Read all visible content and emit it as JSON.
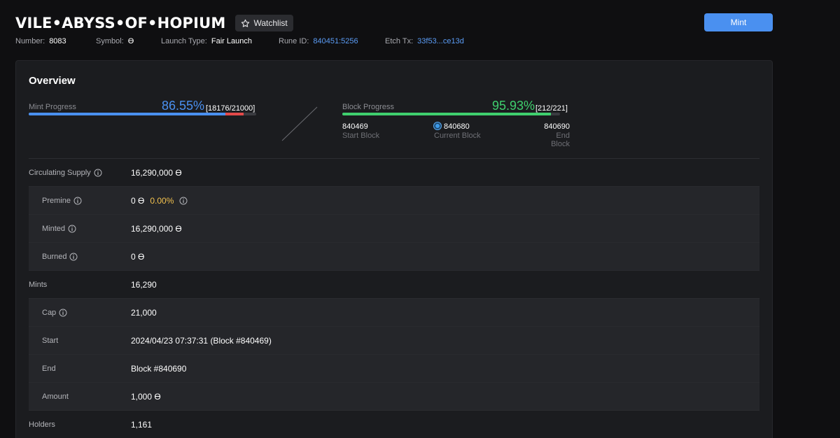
{
  "header": {
    "rune_name": "VILE•ABYSS•OF•HOPIUM",
    "watchlist_label": "Watchlist",
    "mint_label": "Mint"
  },
  "meta": {
    "number_label": "Number:",
    "number_value": "8083",
    "symbol_label": "Symbol:",
    "symbol_value": "ϴ",
    "launch_label": "Launch Type:",
    "launch_value": "Fair Launch",
    "rune_id_label": "Rune ID:",
    "rune_id_value": "840451:5256",
    "etch_label": "Etch Tx:",
    "etch_value": "33f53...ce13d"
  },
  "overview": {
    "title": "Overview",
    "mint_progress": {
      "label": "Mint Progress",
      "percent_text": "86.55%",
      "count_text": "[18176/21000]",
      "percent": 86.55,
      "color": "#4a90f0"
    },
    "block_progress": {
      "label": "Block Progress",
      "percent_text": "95.93%",
      "count_text": "[212/221]",
      "percent": 95.93,
      "color": "#3fcf6e",
      "start_block": "840469",
      "start_label": "Start Block",
      "current_block": "840680",
      "current_label": "Current Block",
      "end_block": "840690",
      "end_label": "End Block"
    }
  },
  "details": {
    "circulating_label": "Circulating Supply",
    "circulating_value": "16,290,000 ϴ",
    "premine_label": "Premine",
    "premine_value": "0 ϴ",
    "premine_pct": "0.00%",
    "minted_label": "Minted",
    "minted_value": "16,290,000 ϴ",
    "burned_label": "Burned",
    "burned_value": "0 ϴ",
    "mints_label": "Mints",
    "mints_value": "16,290",
    "cap_label": "Cap",
    "cap_value": "21,000",
    "start_label": "Start",
    "start_value": "2024/04/23 07:37:31 (Block #840469)",
    "end_label": "End",
    "end_value": "Block #840690",
    "amount_label": "Amount",
    "amount_value": "1,000 ϴ",
    "holders_label": "Holders",
    "holders_value": "1,161"
  },
  "colors": {
    "accent": "#4a90f0",
    "link": "#5b9cf5",
    "green": "#3fcf6e",
    "red": "#e34a4a",
    "yellow": "#f2c14e"
  }
}
